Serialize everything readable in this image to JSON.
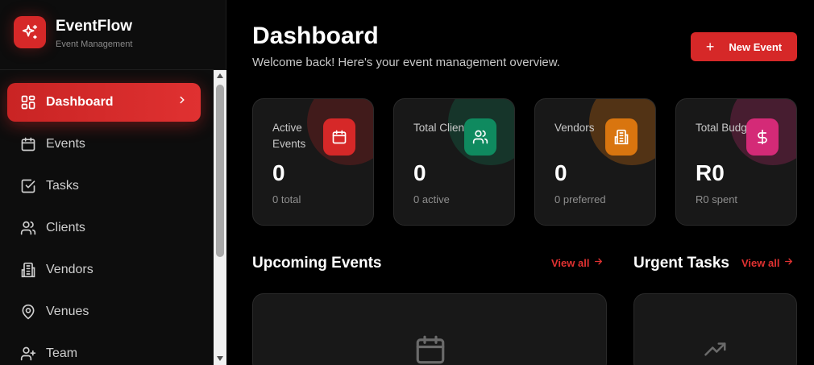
{
  "brand": {
    "title": "EventFlow",
    "subtitle": "Event Management",
    "accent": "#d62828"
  },
  "sidebar": {
    "items": [
      {
        "label": "Dashboard",
        "icon": "grid-icon",
        "active": true
      },
      {
        "label": "Events",
        "icon": "calendar-icon"
      },
      {
        "label": "Tasks",
        "icon": "check-square-icon"
      },
      {
        "label": "Clients",
        "icon": "users-icon"
      },
      {
        "label": "Vendors",
        "icon": "building-icon"
      },
      {
        "label": "Venues",
        "icon": "map-pin-icon"
      },
      {
        "label": "Team",
        "icon": "team-icon"
      }
    ]
  },
  "header": {
    "title": "Dashboard",
    "subtitle": "Welcome back! Here's your event management overview.",
    "new_event_label": "New Event"
  },
  "stats": [
    {
      "label": "Active Events",
      "value": "0",
      "note": "0 total",
      "icon": "calendar-icon",
      "color": "#d62828"
    },
    {
      "label": "Total Clients",
      "value": "0",
      "note": "0 active",
      "icon": "users-icon",
      "color": "#0f8a5f"
    },
    {
      "label": "Vendors",
      "value": "0",
      "note": "0 preferred",
      "icon": "building-icon",
      "color": "#d9750f"
    },
    {
      "label": "Total Budget",
      "value": "R0",
      "note": "R0 spent",
      "icon": "dollar-icon",
      "color": "#d42a77"
    }
  ],
  "sections": {
    "upcoming": {
      "title": "Upcoming Events",
      "view_all": "View all"
    },
    "urgent": {
      "title": "Urgent Tasks",
      "view_all": "View all"
    }
  }
}
